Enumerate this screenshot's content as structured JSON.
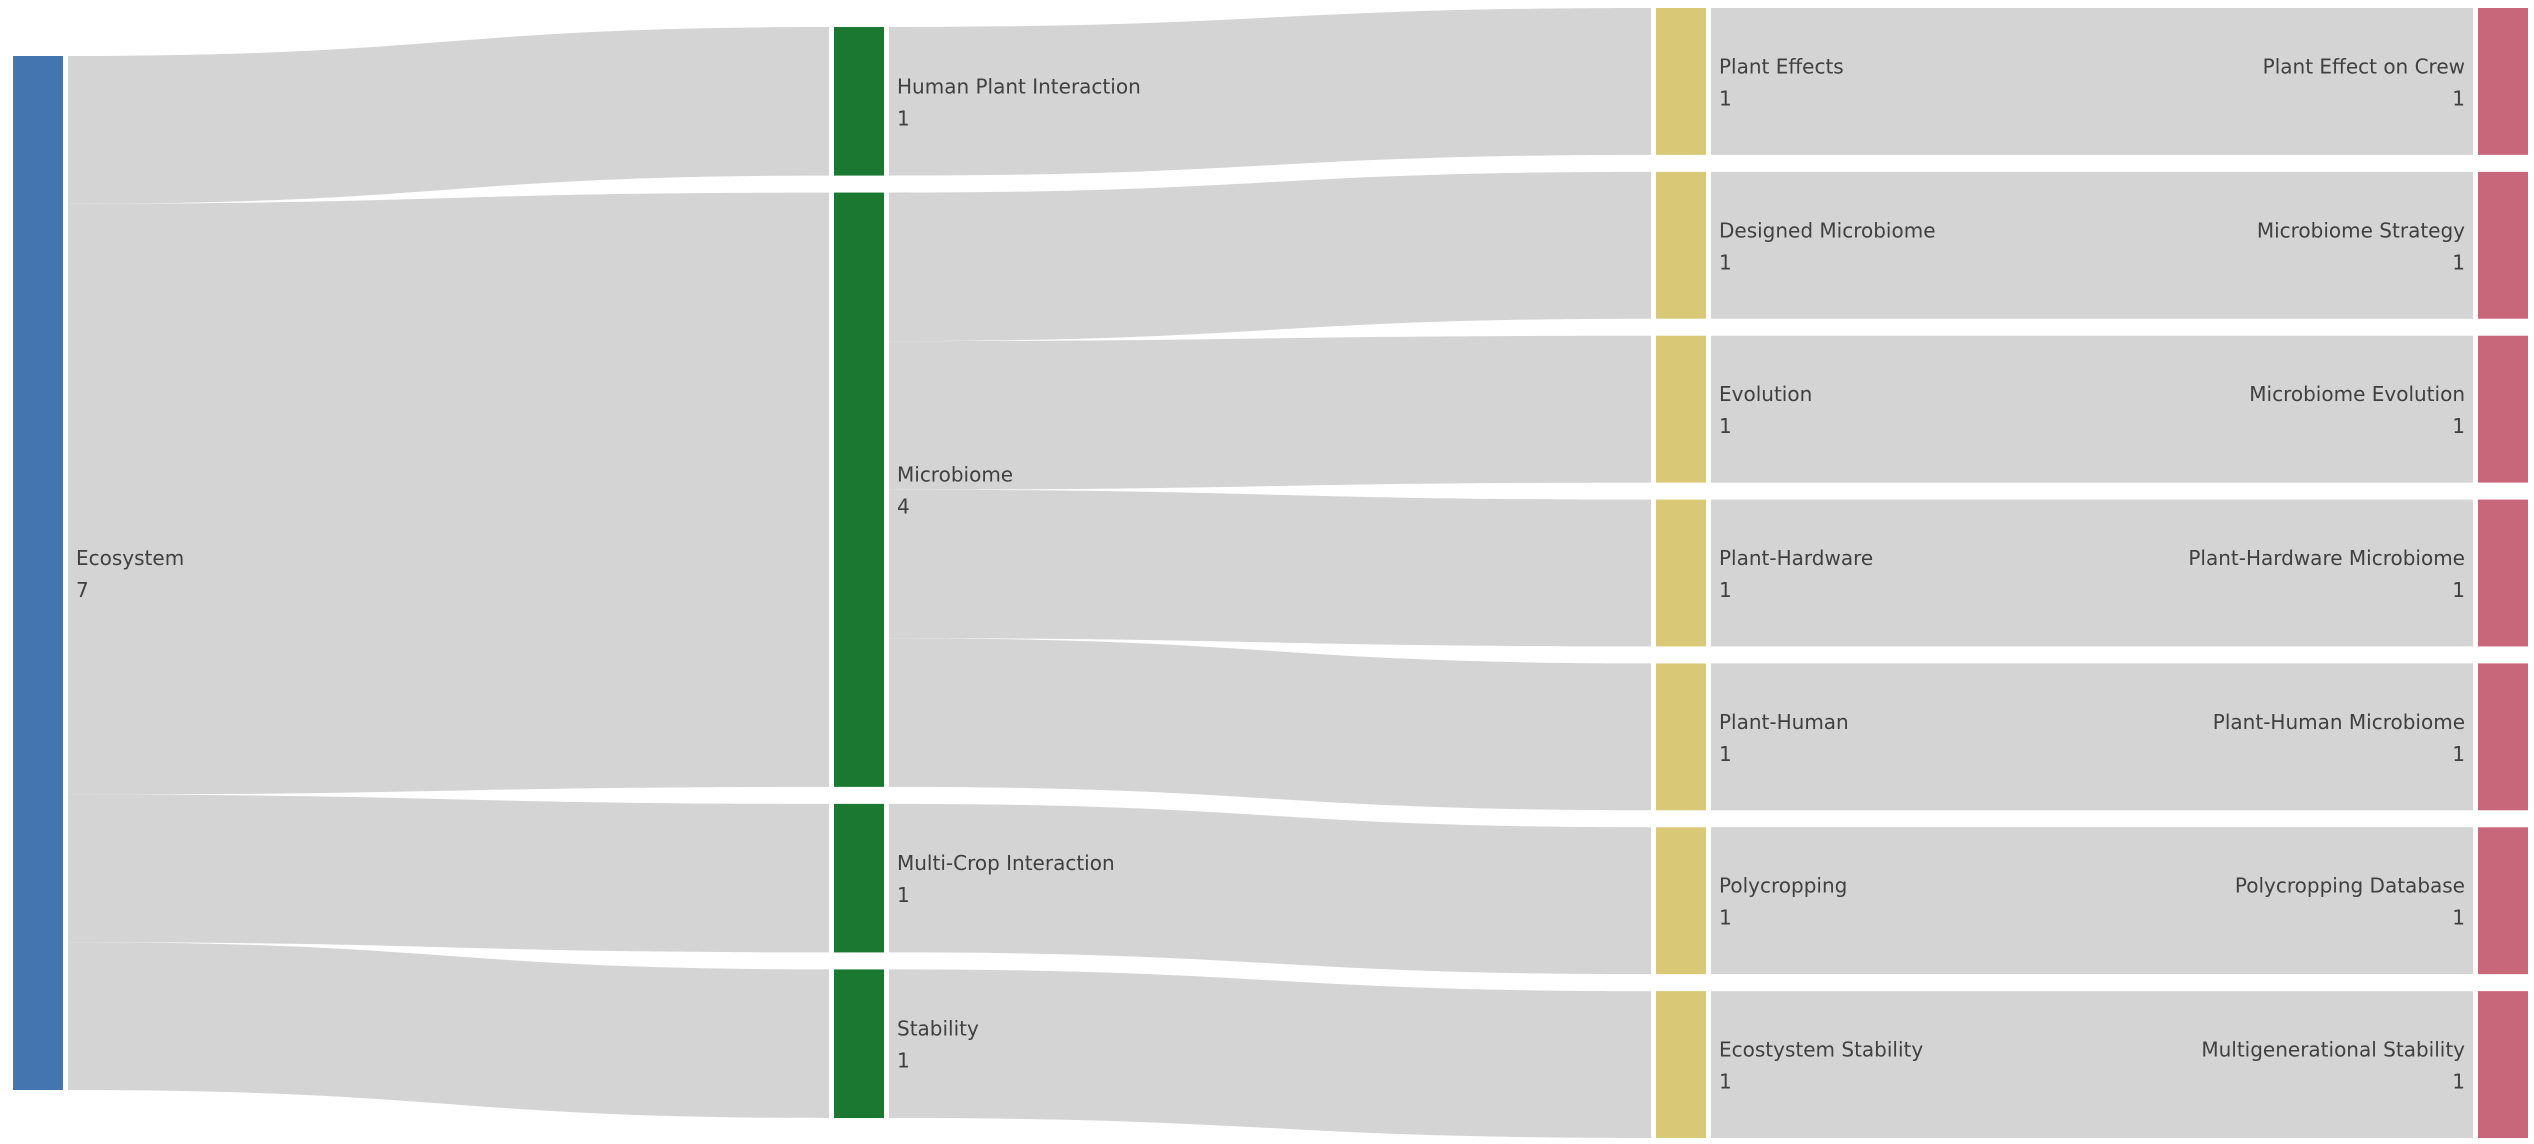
{
  "chart_data": {
    "type": "sankey",
    "levels": [
      {
        "color": "#4575AE"
      },
      {
        "color": "#1A7830"
      },
      {
        "color": "#D9C976"
      },
      {
        "color": "#C8677A"
      }
    ],
    "nodes": [
      {
        "id": "ecosystem",
        "label": "Ecosystem",
        "value": 7,
        "level": 0
      },
      {
        "id": "human-plant-interaction",
        "label": "Human Plant Interaction",
        "value": 1,
        "level": 1
      },
      {
        "id": "microbiome",
        "label": "Microbiome",
        "value": 4,
        "level": 1
      },
      {
        "id": "multi-crop-interaction",
        "label": "Multi-Crop Interaction",
        "value": 1,
        "level": 1
      },
      {
        "id": "stability",
        "label": "Stability",
        "value": 1,
        "level": 1
      },
      {
        "id": "plant-effects",
        "label": "Plant Effects",
        "value": 1,
        "level": 2
      },
      {
        "id": "designed-microbiome",
        "label": "Designed Microbiome",
        "value": 1,
        "level": 2
      },
      {
        "id": "evolution",
        "label": "Evolution",
        "value": 1,
        "level": 2
      },
      {
        "id": "plant-hardware",
        "label": "Plant-Hardware",
        "value": 1,
        "level": 2
      },
      {
        "id": "plant-human",
        "label": "Plant-Human",
        "value": 1,
        "level": 2
      },
      {
        "id": "polycropping",
        "label": "Polycropping",
        "value": 1,
        "level": 2
      },
      {
        "id": "ecosystem-stability",
        "label": "Ecostystem Stability",
        "value": 1,
        "level": 2
      },
      {
        "id": "plant-effect-on-crew",
        "label": "Plant Effect on Crew",
        "value": 1,
        "level": 3
      },
      {
        "id": "microbiome-strategy",
        "label": "Microbiome Strategy",
        "value": 1,
        "level": 3
      },
      {
        "id": "microbiome-evolution",
        "label": "Microbiome Evolution",
        "value": 1,
        "level": 3
      },
      {
        "id": "plant-hardware-microbiome",
        "label": "Plant-Hardware Microbiome",
        "value": 1,
        "level": 3
      },
      {
        "id": "plant-human-microbiome",
        "label": "Plant-Human Microbiome",
        "value": 1,
        "level": 3
      },
      {
        "id": "polycropping-database",
        "label": "Polycropping Database",
        "value": 1,
        "level": 3
      },
      {
        "id": "multigenerational-stability",
        "label": "Multigenerational Stability",
        "value": 1,
        "level": 3
      }
    ],
    "links": [
      {
        "source": "ecosystem",
        "target": "human-plant-interaction",
        "value": 1
      },
      {
        "source": "ecosystem",
        "target": "microbiome",
        "value": 4
      },
      {
        "source": "ecosystem",
        "target": "multi-crop-interaction",
        "value": 1
      },
      {
        "source": "ecosystem",
        "target": "stability",
        "value": 1
      },
      {
        "source": "human-plant-interaction",
        "target": "plant-effects",
        "value": 1
      },
      {
        "source": "microbiome",
        "target": "designed-microbiome",
        "value": 1
      },
      {
        "source": "microbiome",
        "target": "evolution",
        "value": 1
      },
      {
        "source": "microbiome",
        "target": "plant-hardware",
        "value": 1
      },
      {
        "source": "microbiome",
        "target": "plant-human",
        "value": 1
      },
      {
        "source": "multi-crop-interaction",
        "target": "polycropping",
        "value": 1
      },
      {
        "source": "stability",
        "target": "ecosystem-stability",
        "value": 1
      },
      {
        "source": "plant-effects",
        "target": "plant-effect-on-crew",
        "value": 1
      },
      {
        "source": "designed-microbiome",
        "target": "microbiome-strategy",
        "value": 1
      },
      {
        "source": "evolution",
        "target": "microbiome-evolution",
        "value": 1
      },
      {
        "source": "plant-hardware",
        "target": "plant-hardware-microbiome",
        "value": 1
      },
      {
        "source": "plant-human",
        "target": "plant-human-microbiome",
        "value": 1
      },
      {
        "source": "polycropping",
        "target": "polycropping-database",
        "value": 1
      },
      {
        "source": "ecosystem-stability",
        "target": "multigenerational-stability",
        "value": 1
      }
    ],
    "link_color": "#D4D4D4"
  }
}
